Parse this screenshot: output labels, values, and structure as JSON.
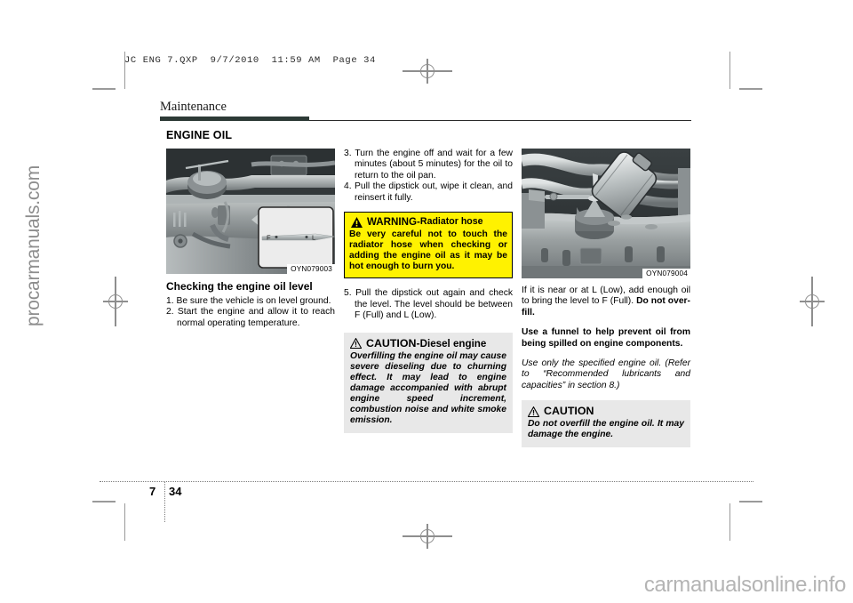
{
  "prepress": {
    "slug": "JC ENG 7.QXP  9/7/2010  11:59 AM  Page 34"
  },
  "header": {
    "chapter_title": "Maintenance",
    "section_title": "ENGINE OIL"
  },
  "columns": {
    "left": {
      "figure_caption": "OYN079003",
      "figure_dipstick_full_mark": "F",
      "figure_dipstick_low_mark": "L",
      "subhead": "Checking the engine oil level",
      "steps": [
        {
          "num": "1.",
          "text": "Be sure the vehicle is on level ground."
        },
        {
          "num": "2.",
          "text": "Start the engine and allow it to reach normal operating temperature."
        }
      ]
    },
    "middle": {
      "steps": [
        {
          "num": "3.",
          "text": "Turn the engine off and wait for a few minutes (about 5 minutes) for the oil to return to the oil pan."
        },
        {
          "num": "4.",
          "text": "Pull the dipstick out, wipe it clean, and reinsert it fully."
        }
      ],
      "warning": {
        "icon": "filled-warning-triangle-icon",
        "label": "WARNING",
        "separator": " - ",
        "subject": "Radiator hose",
        "body": "Be very careful not to touch the radiator hose when checking or adding the engine oil as it may be hot enough to burn you."
      },
      "steps2": [
        {
          "num": "5.",
          "text": "Pull the dipstick out again and check the level. The level should be between F (Full) and L (Low)."
        }
      ],
      "caution": {
        "icon": "outline-caution-triangle-icon",
        "label": "CAUTION",
        "separator": " - ",
        "subject": "Diesel engine",
        "body": "Overfilling the engine oil may cause severe dieseling due to churning effect. It may lead to engine damage accompanied with abrupt engine speed increment, combustion noise and white smoke emission."
      }
    },
    "right": {
      "figure_caption": "OYN079004",
      "para1_plain": "If it is near or at L (Low), add enough oil to bring the level to F (Full). ",
      "para1_bold": "Do not over-fill.",
      "para2_bold": "Use a funnel to help prevent oil from being spilled on engine components.",
      "para3_italic": "Use only the specified engine oil. (Refer to “Recommended lubricants and capacities” in section 8.)",
      "caution": {
        "icon": "outline-caution-triangle-icon",
        "label": "CAUTION",
        "body": "Do not overfill the engine oil. It may damage the engine."
      }
    }
  },
  "footer": {
    "chapter_number": "7",
    "page_number": "34"
  },
  "watermarks": {
    "left": "procarmanuals.com",
    "bottom_right": "carmanualsonline.info"
  },
  "colors": {
    "warning_yellow": "#fff200",
    "caution_gray": "#e8e8e8",
    "chapter_bar": "#2d3a36",
    "watermark_gray": "#b4b4b4"
  }
}
